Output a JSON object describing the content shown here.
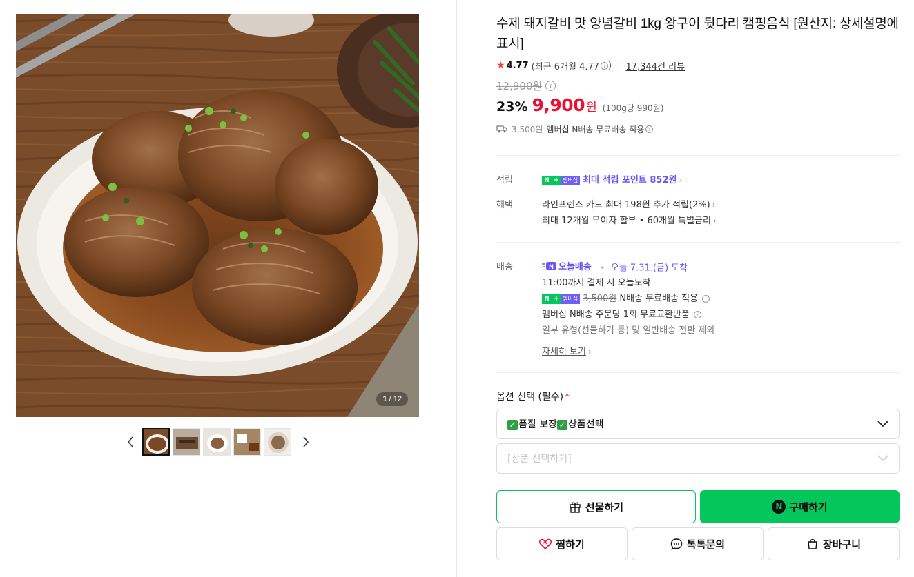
{
  "gallery": {
    "counter_current": "1",
    "counter_total": "12",
    "counter_sep": " / "
  },
  "product": {
    "title": "수제 돼지갈비 맛 양념갈비 1kg 왕구이 뒷다리 캠핑음식 [원산지: 상세설명에 표시]",
    "rating": "4.77",
    "rating_recent": "(최근 6개월 4.77",
    "rating_recent_close": ")",
    "review_count": "17,344건 리뷰",
    "original_price": "12,900원",
    "discount": "23%",
    "price": "9,900",
    "price_currency": "원",
    "unit_price": "(100g당 990원)",
    "ship_original": "3,500원",
    "ship_text": "멤버십 N배송 무료배송 적용"
  },
  "benefits": {
    "points_label": "적립",
    "points_badge_member": "멤버십",
    "points_text": "최대 적립 포인트 852원",
    "benefit_label": "혜택",
    "benefit_line1": "라인프렌즈 카드 최대 198원 추가 적립(2%)",
    "benefit_line2": "최대 12개월 무이자 할부 • 60개월 특별금리"
  },
  "delivery": {
    "label": "배송",
    "today_badge": "오늘배송",
    "today_date": "오늘 7.31.(금) 도착",
    "cutoff": "11:00까지 결제 시 오늘도착",
    "badge_member": "멤버십",
    "ship_original": "3,500원",
    "ship_text": "N배송 무료배송 적용",
    "exchange": "멤버십 N배송 주문당 1회 무료교환반품",
    "exception": "일부 유형(선물하기 등) 및 일반배송 전환 제외",
    "more": "자세히 보기"
  },
  "options": {
    "label": "옵션 선택 (필수)",
    "required_mark": "*",
    "select1_part1": "품질 보장",
    "select1_part2": "상품선택",
    "select2_placeholder": "[상품 선택하기]"
  },
  "buttons": {
    "gift": "선물하기",
    "buy": "구매하기",
    "wish": "찜하기",
    "talk": "톡톡문의",
    "cart": "장바구니"
  },
  "colors": {
    "naver_green": "#03c75a",
    "price_red": "#ed0f32",
    "membership_purple": "#6a55f5"
  }
}
